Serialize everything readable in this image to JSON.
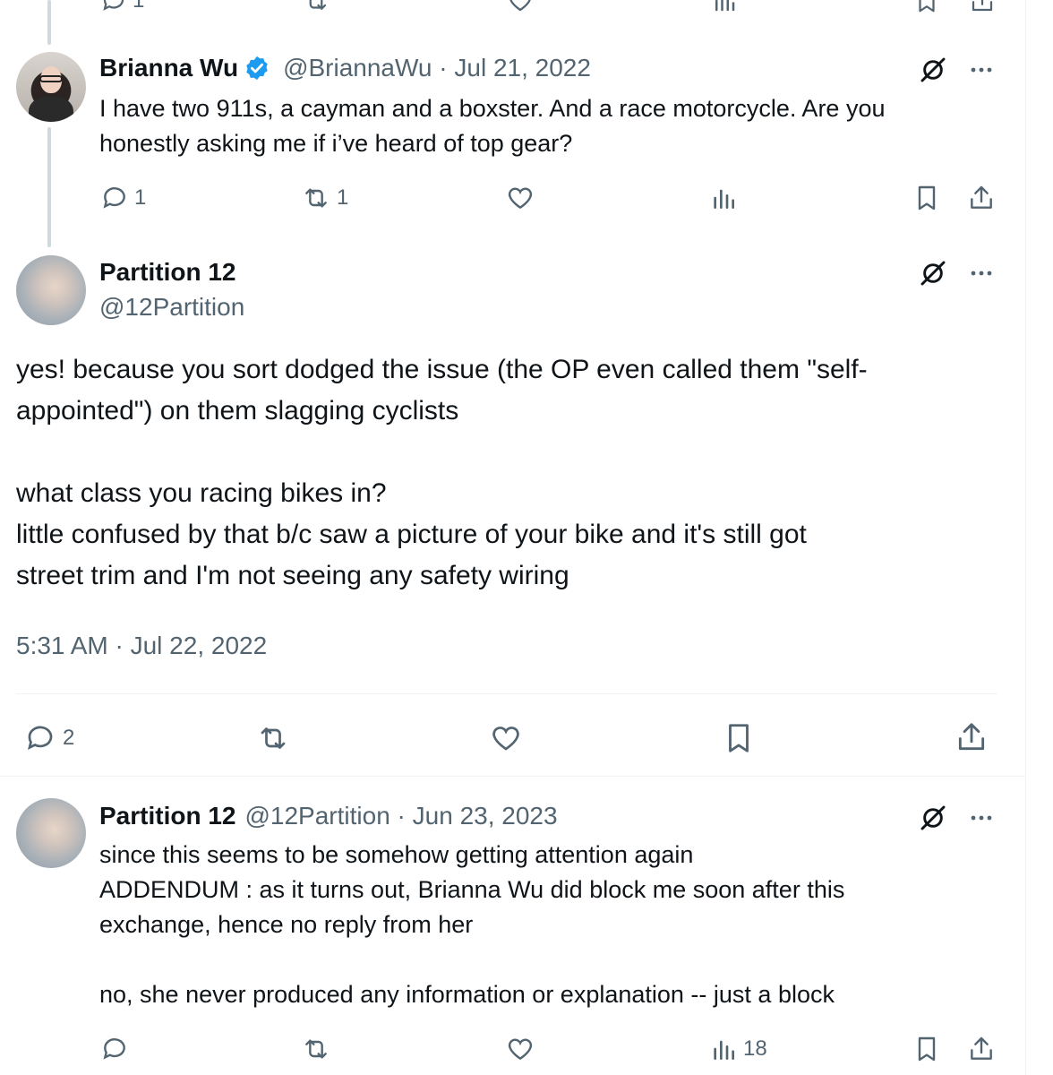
{
  "tweets": [
    {
      "author_name": "Brianna Wu",
      "handle_date": "@BriannaWu · Jul 21, 2022",
      "text": "I have two 911s, a cayman and a boxster. And a race motorcycle. Are you\nhonestly asking me if i’ve heard of top gear?",
      "replies": "1",
      "reposts": "1"
    },
    {
      "author_name": "Partition 12",
      "handle": "@12Partition",
      "text": "yes! because you sort dodged the issue (the OP even called them \"self-\nappointed\") on them slagging cyclists\n\nwhat class you racing bikes in?\nlittle confused by that b/c saw a picture of your bike and it's still got\nstreet trim and I'm not seeing any safety wiring",
      "timestamp": "5:31 AM · Jul 22, 2022",
      "replies": "2"
    },
    {
      "author_name": "Partition 12",
      "handle_date": "@12Partition · Jun 23, 2023",
      "text": "since this seems to be somehow getting attention again\nADDENDUM : as it turns out, Brianna Wu did block me soon after this\nexchange, hence no reply from her\n\nno, she never produced any information or explanation -- just a block",
      "views": "18"
    }
  ],
  "top_partial": {
    "replies": "1"
  },
  "colors": {
    "text": "#0f1419",
    "secondary": "#536471",
    "verified": "#1d9bf0",
    "thread_line": "#cfd9de"
  },
  "icons": [
    "reply-icon",
    "repost-icon",
    "like-icon",
    "views-icon",
    "bookmark-icon",
    "share-icon",
    "grok-icon",
    "more-icon",
    "verified-badge-icon"
  ]
}
